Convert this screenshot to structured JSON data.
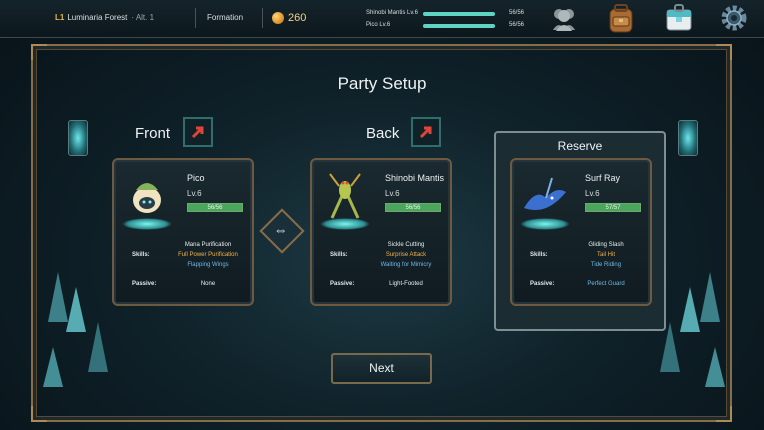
{
  "topbar": {
    "level": "L1",
    "location": "Luminaria Forest",
    "altitude": "· Alt. 1",
    "formation_label": "Formation",
    "gold": "260",
    "party_hp": [
      {
        "name": "Shinobi Mantis Lv.6",
        "hp": "56/56",
        "fraction": 1.0
      },
      {
        "name": "Pico Lv.6",
        "hp": "56/56",
        "fraction": 1.0
      }
    ],
    "icons": [
      "party-icon",
      "backpack-icon",
      "shop-icon",
      "settings-gear-icon"
    ]
  },
  "title": "Party Setup",
  "front_label": "Front",
  "back_label": "Back",
  "reserve_label": "Reserve",
  "skills_label": "Skills:",
  "passive_label": "Passive:",
  "cards": {
    "front": {
      "name": "Pico",
      "level": "Lv.6",
      "hp": "56/56",
      "hp_fraction": 1.0,
      "skills": [
        "Mana Purification",
        "Full Power Purification",
        "Flapping Wings"
      ],
      "passive": "None"
    },
    "back": {
      "name": "Shinobi Mantis",
      "level": "Lv.6",
      "hp": "56/56",
      "hp_fraction": 1.0,
      "skills": [
        "Sickle Cutting",
        "Surprise Attack",
        "Waiting for Mimicry"
      ],
      "passive": "Light-Footed"
    },
    "reserve": {
      "name": "Surf Ray",
      "level": "Lv.6",
      "hp": "57/57",
      "hp_fraction": 1.0,
      "skills": [
        "Gliding Slash",
        "Tail Hit",
        "Tide Riding"
      ],
      "passive": "Perfect Guard"
    }
  },
  "next_label": "Next",
  "colors": {
    "gold": "#f1d08a",
    "hp_fill": "#4aa65d",
    "skill_orange": "#f2b24b",
    "skill_blue": "#6fb8e8",
    "frame": "#8a6d46"
  }
}
